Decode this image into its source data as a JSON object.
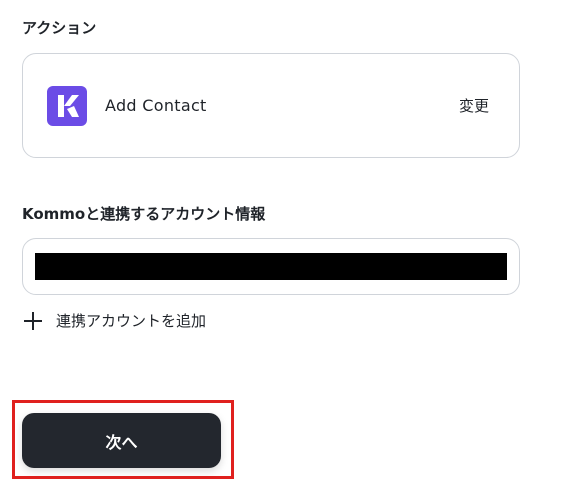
{
  "action_section": {
    "label": "アクション",
    "action_name": "Add Contact",
    "change_label": "変更",
    "app_icon": "kommo-logo",
    "app_color": "#6b4ce6"
  },
  "account_section": {
    "label": "Kommoと連携するアカウント情報",
    "selected_account": "",
    "add_account_label": "連携アカウントを追加"
  },
  "footer": {
    "next_label": "次へ",
    "highlight_color": "#e0201e"
  }
}
